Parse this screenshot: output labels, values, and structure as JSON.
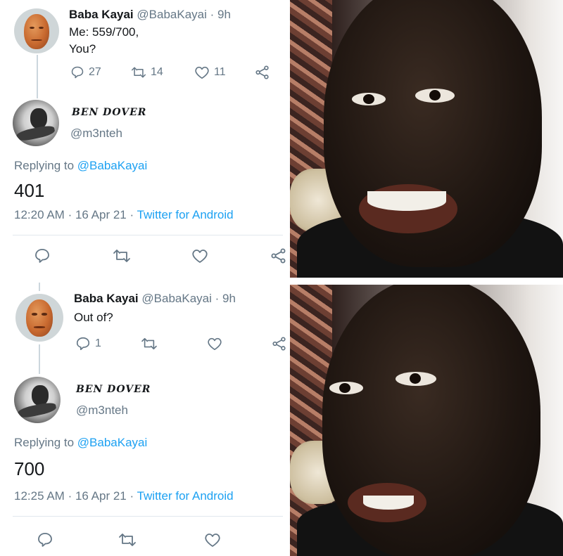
{
  "panels": [
    {
      "tweet": {
        "name": "Baba Kayai",
        "handle": "@BabaKayai",
        "separator": "·",
        "age": "9h",
        "text_line1": "Me: 559/700,",
        "text_line2": "You?",
        "replies": "27",
        "retweets": "14",
        "likes": "11"
      },
      "reply": {
        "name": "BEN DOVER",
        "handle": "@m3nteh",
        "replying_prefix": "Replying to",
        "replying_to": "@BabaKayai",
        "text": "401",
        "time": "12:20 AM",
        "separator": "·",
        "date": "16 Apr 21",
        "separator2": "·",
        "source": "Twitter for Android"
      }
    },
    {
      "tweet": {
        "name": "Baba Kayai",
        "handle": "@BabaKayai",
        "separator": "·",
        "age": "9h",
        "text_line1": "Out of?",
        "replies": "1"
      },
      "reply": {
        "name": "BEN DOVER",
        "handle": "@m3nteh",
        "replying_prefix": "Replying to",
        "replying_to": "@BabaKayai",
        "text": "700",
        "time": "12:25 AM",
        "separator": "·",
        "date": "16 Apr 21",
        "separator2": "·",
        "source": "Twitter for Android"
      }
    }
  ],
  "icons": {
    "reply": "reply-icon",
    "retweet": "retweet-icon",
    "like": "heart-icon",
    "share": "share-icon"
  },
  "colors": {
    "link": "#1da1f2",
    "muted": "#657786",
    "text": "#14171a"
  }
}
